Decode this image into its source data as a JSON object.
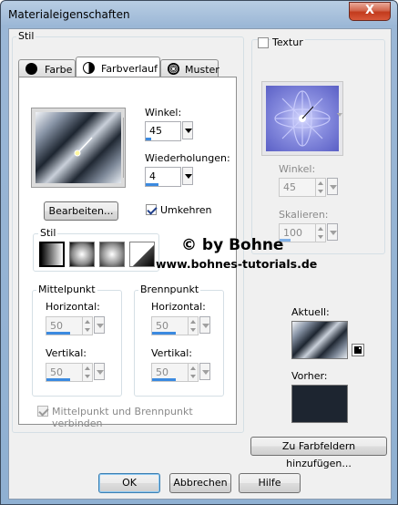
{
  "window": {
    "title": "Materialeigenschaften",
    "close_label": "X"
  },
  "left": {
    "group_label": "Stil",
    "tabs": [
      {
        "label": "Farbe"
      },
      {
        "label": "Farbverlauf"
      },
      {
        "label": "Muster"
      }
    ],
    "angle_label": "Winkel:",
    "angle_value": "45",
    "repeats_label": "Wiederholungen:",
    "repeats_value": "4",
    "edit_button": "Bearbeiten...",
    "invert_label": "Umkehren",
    "invert_checked": true,
    "style_group_label": "Stil",
    "center": {
      "label": "Mittelpunkt",
      "horizontal_label": "Horizontal:",
      "horizontal_value": "50",
      "vertical_label": "Vertikal:",
      "vertical_value": "50"
    },
    "focal": {
      "label": "Brennpunkt",
      "horizontal_label": "Horizontal:",
      "horizontal_value": "50",
      "vertical_label": "Vertikal:",
      "vertical_value": "50"
    },
    "link_label": "Mittelpunkt und Brennpunkt verbinden",
    "link_checked": true
  },
  "right": {
    "texture_label": "Textur",
    "texture_checked": false,
    "angle_label": "Winkel:",
    "angle_value": "45",
    "scale_label": "Skalieren:",
    "scale_value": "100",
    "current_label": "Aktuell:",
    "previous_label": "Vorher:",
    "add_swatch_button": "Zu Farbfeldern hinzufügen..."
  },
  "watermark": {
    "line1": "© by Bohne",
    "line2": "www.bohnes-tutorials.de"
  },
  "footer": {
    "ok": "OK",
    "cancel": "Abbrechen",
    "help": "Hilfe"
  }
}
